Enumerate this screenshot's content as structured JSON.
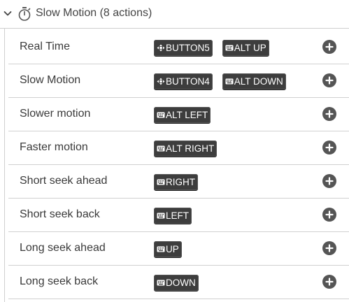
{
  "group": {
    "title": "Slow Motion (8 actions)",
    "expand_icon": "chevron-down-icon",
    "group_icon": "stopwatch-icon"
  },
  "actions": [
    {
      "label": "Real Time",
      "keys": [
        {
          "icon": "mouse-icon",
          "text": "BUTTON5"
        },
        {
          "icon": "keyboard-icon",
          "text": "ALT UP"
        }
      ]
    },
    {
      "label": "Slow Motion",
      "keys": [
        {
          "icon": "mouse-icon",
          "text": "BUTTON4"
        },
        {
          "icon": "keyboard-icon",
          "text": "ALT DOWN"
        }
      ]
    },
    {
      "label": "Slower motion",
      "keys": [
        {
          "icon": "keyboard-icon",
          "text": "ALT LEFT"
        }
      ]
    },
    {
      "label": "Faster motion",
      "keys": [
        {
          "icon": "keyboard-icon",
          "text": "ALT RIGHT"
        }
      ]
    },
    {
      "label": "Short seek ahead",
      "keys": [
        {
          "icon": "keyboard-icon",
          "text": "RIGHT"
        }
      ]
    },
    {
      "label": "Short seek back",
      "keys": [
        {
          "icon": "keyboard-icon",
          "text": "LEFT"
        }
      ]
    },
    {
      "label": "Long seek ahead",
      "keys": [
        {
          "icon": "keyboard-icon",
          "text": "UP"
        }
      ]
    },
    {
      "label": "Long seek back",
      "keys": [
        {
          "icon": "keyboard-icon",
          "text": "DOWN"
        }
      ]
    }
  ],
  "add_icon": "plus-circle-icon",
  "colors": {
    "key_bg": "#3d3d3d",
    "key_text": "#ffffff",
    "add_btn_bg": "#555555",
    "divider": "#d0d0d0"
  }
}
